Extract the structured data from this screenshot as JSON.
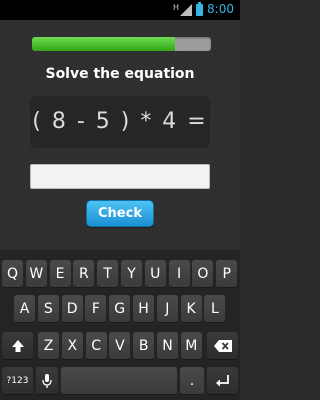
{
  "status_bar": {
    "network_type": "H",
    "time": "8:00",
    "battery_color": "#33b5e5"
  },
  "quiz": {
    "progress": 0.8,
    "prompt": "Solve the equation",
    "equation": "( 8 - 5 ) * 4 =",
    "answer_value": "",
    "answer_placeholder": "",
    "check_label": "Check",
    "check_color": "#33b5e5",
    "progress_color": "#4fc831"
  },
  "keyboard": {
    "row1": [
      "Q",
      "W",
      "E",
      "R",
      "T",
      "Y",
      "U",
      "I",
      "O",
      "P"
    ],
    "row2": [
      "A",
      "S",
      "D",
      "F",
      "G",
      "H",
      "J",
      "K",
      "L"
    ],
    "row3": [
      "Z",
      "X",
      "C",
      "V",
      "B",
      "N",
      "M"
    ],
    "symbols_label": "?123",
    "period_label": ".",
    "icons": {
      "shift": "shift-arrow-icon",
      "backspace": "backspace-icon",
      "mic": "microphone-icon",
      "enter": "enter-icon"
    }
  }
}
